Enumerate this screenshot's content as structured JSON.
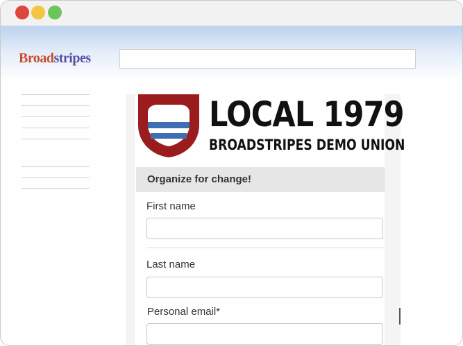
{
  "brand": {
    "part1": "Broad",
    "part2": "stripes",
    "color1": "#c94a2f",
    "color2": "#5b4fa8"
  },
  "window": {
    "controls": [
      "close-dot",
      "minimize-dot",
      "maximize-dot"
    ]
  },
  "search": {
    "value": ""
  },
  "logo": {
    "line1": "LOCAL 1979",
    "line2": "BROADSTRIPES DEMO UNION",
    "emblem": "shield-icon",
    "emblem_colors": {
      "outer": "#9b1c1c",
      "stripe": "#3f6eb4"
    }
  },
  "form": {
    "heading": "Organize for change!",
    "fields": [
      {
        "label": "First name",
        "value": ""
      },
      {
        "label": "Last name",
        "value": ""
      },
      {
        "label": "Personal email*",
        "value": ""
      }
    ]
  }
}
